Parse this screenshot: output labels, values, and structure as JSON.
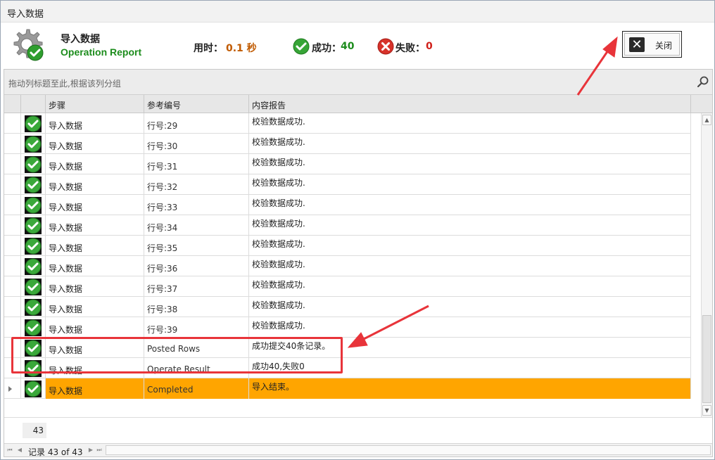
{
  "window": {
    "title": "导入数据"
  },
  "header": {
    "title": "导入数据",
    "subtitle": "Operation Report",
    "elapsed_label": "用时：",
    "elapsed_value": "0.1 秒",
    "success_label": "成功：",
    "success_value": "40",
    "fail_label": "失败：",
    "fail_value": "0",
    "close_label": "关闭"
  },
  "grid": {
    "group_panel_hint": "拖动列标题至此,根据该列分组",
    "columns": [
      "步骤",
      "参考编号",
      "内容报告"
    ],
    "rows": [
      {
        "status": "success",
        "step": "导入数据",
        "ref": "行号:29",
        "report": "校验数据成功."
      },
      {
        "status": "success",
        "step": "导入数据",
        "ref": "行号:30",
        "report": "校验数据成功."
      },
      {
        "status": "success",
        "step": "导入数据",
        "ref": "行号:31",
        "report": "校验数据成功."
      },
      {
        "status": "success",
        "step": "导入数据",
        "ref": "行号:32",
        "report": "校验数据成功."
      },
      {
        "status": "success",
        "step": "导入数据",
        "ref": "行号:33",
        "report": "校验数据成功."
      },
      {
        "status": "success",
        "step": "导入数据",
        "ref": "行号:34",
        "report": "校验数据成功."
      },
      {
        "status": "success",
        "step": "导入数据",
        "ref": "行号:35",
        "report": "校验数据成功."
      },
      {
        "status": "success",
        "step": "导入数据",
        "ref": "行号:36",
        "report": "校验数据成功."
      },
      {
        "status": "success",
        "step": "导入数据",
        "ref": "行号:37",
        "report": "校验数据成功."
      },
      {
        "status": "success",
        "step": "导入数据",
        "ref": "行号:38",
        "report": "校验数据成功."
      },
      {
        "status": "success",
        "step": "导入数据",
        "ref": "行号:39",
        "report": "校验数据成功."
      },
      {
        "status": "success",
        "step": "导入数据",
        "ref": "Posted Rows",
        "report": "成功提交40条记录。"
      },
      {
        "status": "success",
        "step": "导入数据",
        "ref": "Operate Result",
        "report": "成功40,失败0"
      },
      {
        "status": "success",
        "step": "导入数据",
        "ref": "Completed",
        "report": "导入结束。",
        "focused": true
      }
    ],
    "footer_count": "43",
    "record_text": "记录 43 of 43"
  },
  "colors": {
    "focused_row": "#ffa500",
    "success_green": "#1c8c1c",
    "fail_red": "#d0201a",
    "elapsed_orange": "#c05a00",
    "annotation_red": "#e8343a"
  },
  "icons": {
    "header": "gear-check-icon",
    "success": "check-circle-icon",
    "fail": "x-circle-icon",
    "close": "close-x-icon",
    "search": "search-icon"
  }
}
